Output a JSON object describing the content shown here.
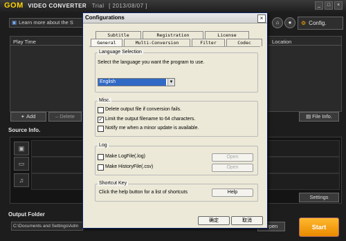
{
  "app": {
    "brand": "GOM",
    "title_suffix": "VIDEO CONVERTER",
    "trial": "Trial",
    "build": "[ 2013/08/07 ]",
    "learn_more": "Learn more about the S",
    "config_label": "Config.",
    "window_min": "_",
    "window_max": "□",
    "window_close": "×"
  },
  "list": {
    "col_playtime": "Play Time",
    "col_location": "Location"
  },
  "toolbar": {
    "add_label": "Add",
    "delete_label": "Delete",
    "file_info_label": "File Info."
  },
  "source": {
    "title": "Source Info.",
    "icons": [
      "film-frame-icon",
      "clapperboard-icon",
      "music-note-icon"
    ]
  },
  "settings_label": "Settings",
  "output": {
    "title": "Output Folder",
    "path": "C:\\Documents and Settings\\Adm",
    "open_label": "Open"
  },
  "start_label": "Start",
  "dialog": {
    "title": "Configurations",
    "close": "×",
    "tabs_row1": [
      "Subtitle",
      "Registration",
      "License"
    ],
    "tabs_row2": [
      "General",
      "Multi-Conversion",
      "Filter",
      "Codec"
    ],
    "active_tab": "General",
    "language": {
      "group": "Language Selection",
      "description": "Select the language you want the program to use.",
      "selected": "English"
    },
    "misc": {
      "group": "Misc.",
      "options": [
        {
          "label": "Delete output file if conversion fails.",
          "checked": false
        },
        {
          "label": "Limit the output filename to 64 characters.",
          "checked": true
        },
        {
          "label": "Notify me when a minor update is available.",
          "checked": false
        }
      ]
    },
    "log": {
      "group": "Log",
      "logfile_label": "Make LogFile(.log)",
      "historyfile_label": "Make HistoryFile(.csv)",
      "open_label": "Open"
    },
    "shortcut": {
      "group": "Shortcut Key",
      "description": "Click the help button for a list of shortcuts",
      "help_label": "Help"
    },
    "ok_label": "确定",
    "cancel_label": "取消"
  }
}
